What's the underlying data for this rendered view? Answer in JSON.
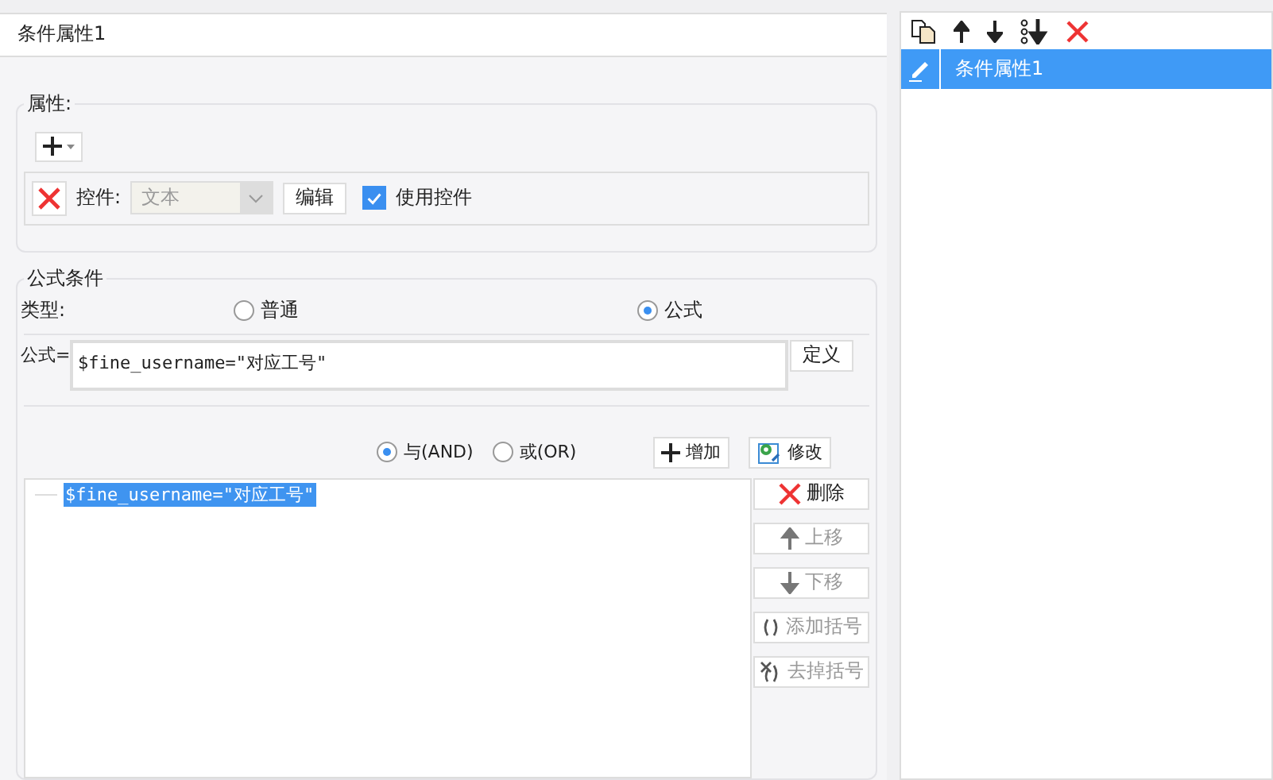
{
  "left_panel": {
    "title": "条件属性1"
  },
  "properties": {
    "legend": "属性:",
    "control_label": "控件:",
    "control_value": "文本",
    "control_disabled": true,
    "edit_button": "编辑",
    "use_control": {
      "label": "使用控件",
      "checked": true
    }
  },
  "formula_condition": {
    "legend": "公式条件",
    "type_label": "类型:",
    "types": [
      {
        "label": "普通",
        "selected": false
      },
      {
        "label": "公式",
        "selected": true
      }
    ],
    "formula_label": "公式=",
    "formula_value": "$fine_username=\"对应工号\"",
    "define_button": "定义",
    "logic": [
      {
        "label": "与(AND)",
        "selected": true
      },
      {
        "label": "或(OR)",
        "selected": false
      }
    ],
    "add_button": "增加",
    "modify_button": "修改",
    "conditions": [
      {
        "text": "$fine_username=\"对应工号\"",
        "selected": true
      }
    ],
    "side_buttons": [
      {
        "kind": "delete",
        "label": "删除",
        "disabled": false
      },
      {
        "kind": "up",
        "label": "上移",
        "disabled": true
      },
      {
        "kind": "down",
        "label": "下移",
        "disabled": true
      },
      {
        "kind": "add_brackets",
        "label": "添加括号",
        "disabled": true
      },
      {
        "kind": "remove_brackets",
        "label": "去掉括号",
        "disabled": true
      }
    ]
  },
  "right_panel": {
    "items": [
      {
        "label": "条件属性1",
        "selected": true
      }
    ]
  }
}
